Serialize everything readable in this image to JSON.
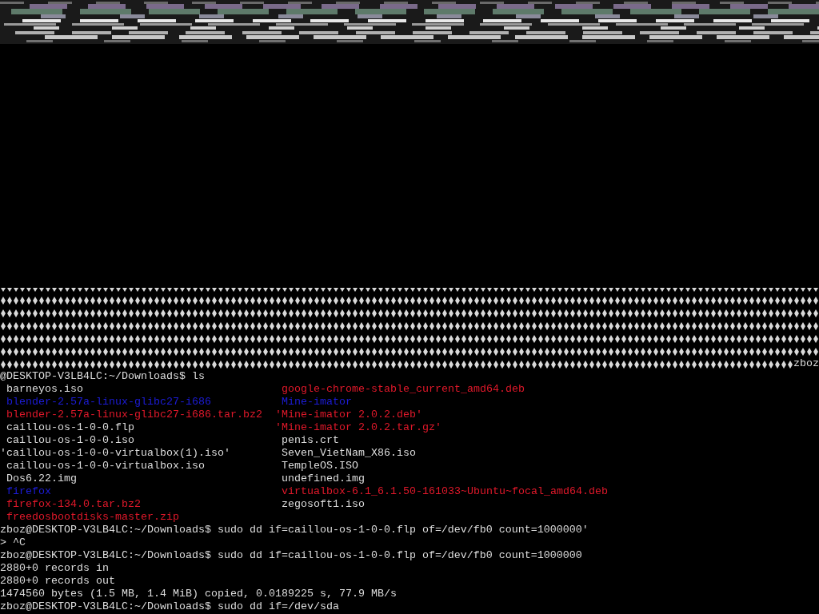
{
  "terminal": {
    "wrapped_text": "zboz",
    "ls_prompt": "@DESKTOP-V3LB4LC:~/Downloads$ ls",
    "listing": [
      [
        {
          "name": "barneyos.iso",
          "color": "#dcdcdc",
          "quoted": false
        },
        {
          "name": "google-chrome-stable_current_amd64.deb",
          "color": "#e0182a",
          "quoted": false
        }
      ],
      [
        {
          "name": "blender-2.57a-linux-glibc27-i686",
          "color": "#1c1cd8",
          "quoted": false
        },
        {
          "name": "Mine-imator",
          "color": "#1c1cd8",
          "quoted": false
        }
      ],
      [
        {
          "name": "blender-2.57a-linux-glibc27-i686.tar.bz2",
          "color": "#e0182a",
          "quoted": false
        },
        {
          "name": "'Mine-imator 2.0.2.deb'",
          "color": "#e0182a",
          "quoted": true
        }
      ],
      [
        {
          "name": "caillou-os-1-0-0.flp",
          "color": "#dcdcdc",
          "quoted": false
        },
        {
          "name": "'Mine-imator 2.0.2.tar.gz'",
          "color": "#e0182a",
          "quoted": true
        }
      ],
      [
        {
          "name": "caillou-os-1-0-0.iso",
          "color": "#dcdcdc",
          "quoted": false
        },
        {
          "name": "penis.crt",
          "color": "#dcdcdc",
          "quoted": false
        }
      ],
      [
        {
          "name": "'caillou-os-1-0-0-virtualbox(1).iso'",
          "color": "#dcdcdc",
          "quoted": true
        },
        {
          "name": "Seven_VietNam_X86.iso",
          "color": "#dcdcdc",
          "quoted": false
        }
      ],
      [
        {
          "name": "caillou-os-1-0-0-virtualbox.iso",
          "color": "#dcdcdc",
          "quoted": false
        },
        {
          "name": "TempleOS.ISO",
          "color": "#dcdcdc",
          "quoted": false
        }
      ],
      [
        {
          "name": "Dos6.22.img",
          "color": "#dcdcdc",
          "quoted": false
        },
        {
          "name": "undefined.img",
          "color": "#dcdcdc",
          "quoted": false
        }
      ],
      [
        {
          "name": "firefox",
          "color": "#1c1cd8",
          "quoted": false
        },
        {
          "name": "virtualbox-6.1_6.1.50-161033~Ubuntu~focal_amd64.deb",
          "color": "#e0182a",
          "quoted": false
        }
      ],
      [
        {
          "name": "firefox-134.0.tar.bz2",
          "color": "#e0182a",
          "quoted": false
        },
        {
          "name": "zegosoft1.iso",
          "color": "#dcdcdc",
          "quoted": false
        }
      ],
      [
        {
          "name": "freedosbootdisks-master.zip",
          "color": "#e0182a",
          "quoted": false
        }
      ]
    ],
    "lines": [
      "zboz@DESKTOP-V3LB4LC:~/Downloads$ sudo dd if=caillou-os-1-0-0.flp of=/dev/fb0 count=1000000'",
      "> ^C",
      "zboz@DESKTOP-V3LB4LC:~/Downloads$ sudo dd if=caillou-os-1-0-0.flp of=/dev/fb0 count=1000000",
      "2880+0 records in",
      "2880+0 records out",
      "1474560 bytes (1.5 MB, 1.4 MiB) copied, 0.0189225 s, 77.9 MB/s",
      "zboz@DESKTOP-V3LB4LC:~/Downloads$ sudo dd if=/dev/sda"
    ]
  }
}
